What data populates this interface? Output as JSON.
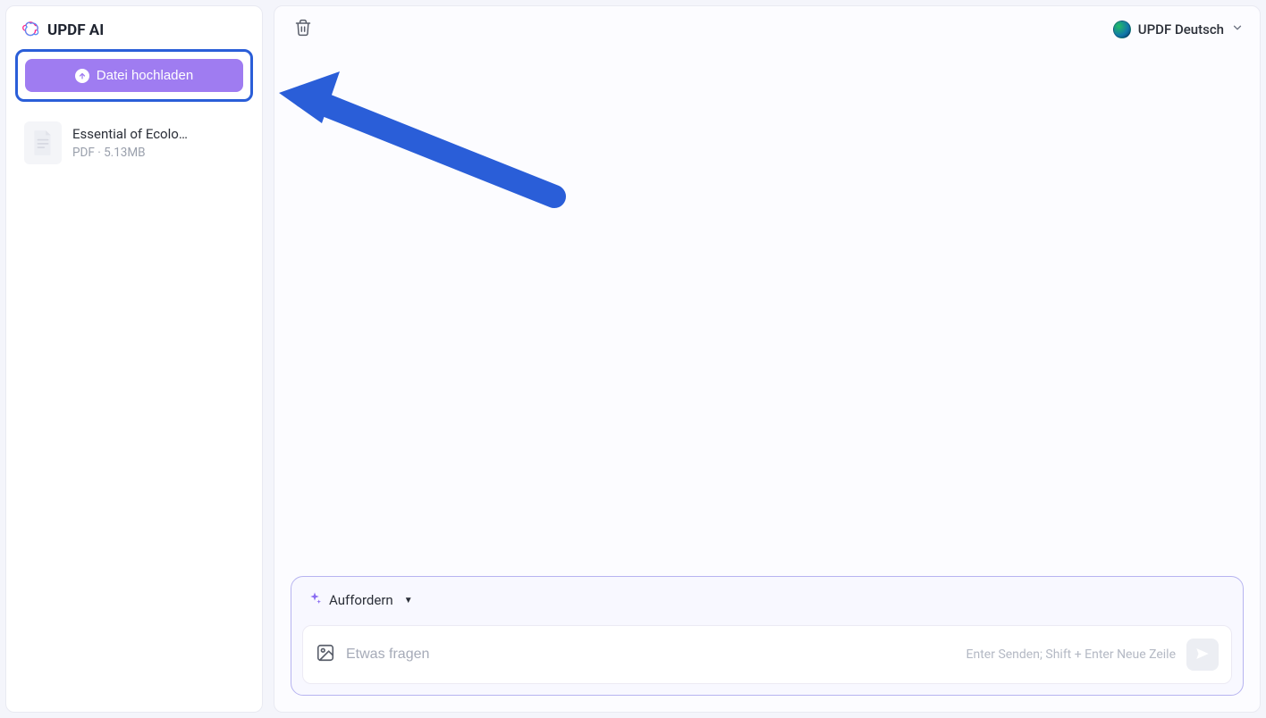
{
  "app": {
    "title": "UPDF AI"
  },
  "sidebar": {
    "upload_label": "Datei hochladen",
    "files": [
      {
        "name": "Essential of Ecolo…",
        "type": "PDF",
        "size": "5.13MB"
      }
    ]
  },
  "topbar": {
    "language_label": "UPDF Deutsch"
  },
  "prompt": {
    "mode_label": "Auffordern",
    "placeholder": "Etwas fragen",
    "hint": "Enter Senden; Shift + Enter Neue Zeile"
  }
}
